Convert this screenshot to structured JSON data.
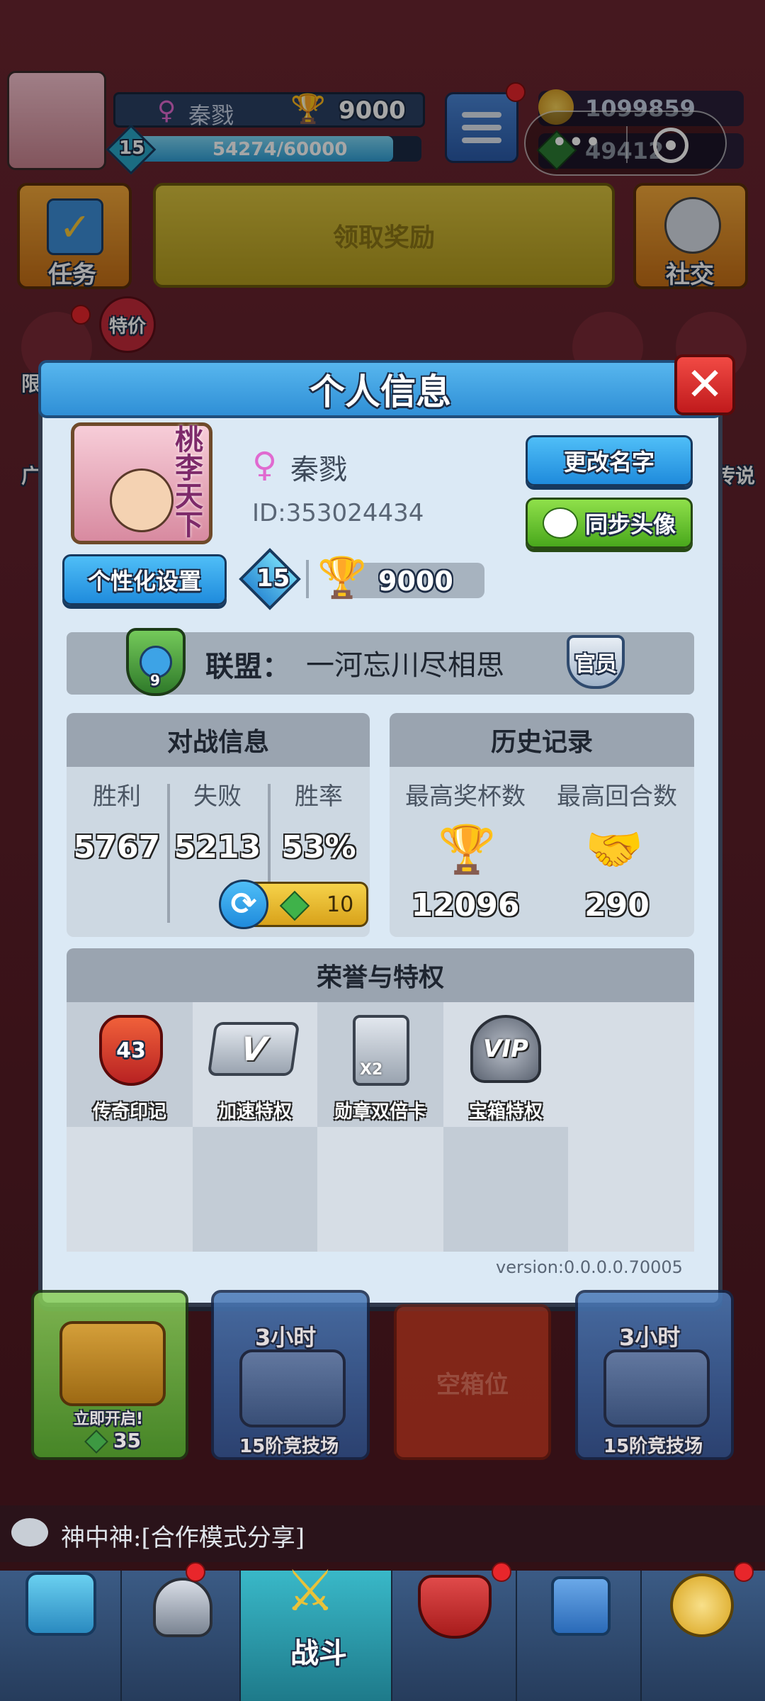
{
  "top_bar": {
    "player_name": "秦戮",
    "trophies": "9000",
    "level": "15",
    "xp": "54274/60000",
    "xp_fraction": 0.905,
    "coins": "1099859",
    "gems": "49412"
  },
  "home": {
    "task_label": "任务",
    "claim_label": "领取奖励",
    "social_label": "社交",
    "special_offer_label": "特价",
    "side_left_1": "限",
    "side_left_2": "广",
    "side_right_1": "传说"
  },
  "profile": {
    "title": "个人信息",
    "avatar_text": "桃李天下",
    "name": "秦戮",
    "id_text": "ID:353024434",
    "rename_label": "更改名字",
    "sync_avatar_label": "同步头像",
    "personalize_label": "个性化设置",
    "level": "15",
    "trophies": "9000",
    "alliance_label": "联盟：",
    "alliance_name": "一河忘川尽相思",
    "alliance_level": "9",
    "alliance_role": "官员",
    "battle": {
      "header": "对战信息",
      "win_label": "胜利",
      "loss_label": "失败",
      "rate_label": "胜率",
      "wins": "5767",
      "losses": "5213",
      "rate": "53%",
      "reset_cost": "10"
    },
    "history": {
      "header": "历史记录",
      "max_trophies_label": "最高奖杯数",
      "max_rounds_label": "最高回合数",
      "max_trophies": "12096",
      "max_rounds": "290"
    },
    "honors": {
      "header": "荣誉与特权",
      "items": [
        {
          "label": "传奇印记",
          "badge": "43"
        },
        {
          "label": "加速特权",
          "badge": "V"
        },
        {
          "label": "勋章双倍卡",
          "badge": "X2"
        },
        {
          "label": "宝箱特权",
          "badge": "VIP"
        }
      ]
    },
    "version": "version:0.0.0.0.70005"
  },
  "chests": [
    {
      "top": "",
      "label": "立即开启!",
      "cost": "35"
    },
    {
      "top": "3小时",
      "label": "15阶竞技场"
    },
    {
      "top": "",
      "label": "空箱位"
    },
    {
      "top": "3小时",
      "label": "15阶竞技场"
    }
  ],
  "chat": {
    "message": "神中神:[合作模式分享]"
  },
  "bottom_nav": {
    "battle_label": "战斗"
  },
  "colors": {
    "accent_blue": "#2f8fd6",
    "accent_green": "#49a81c",
    "trophy_gold": "#f2b01e",
    "badge_red": "#e8262b"
  }
}
